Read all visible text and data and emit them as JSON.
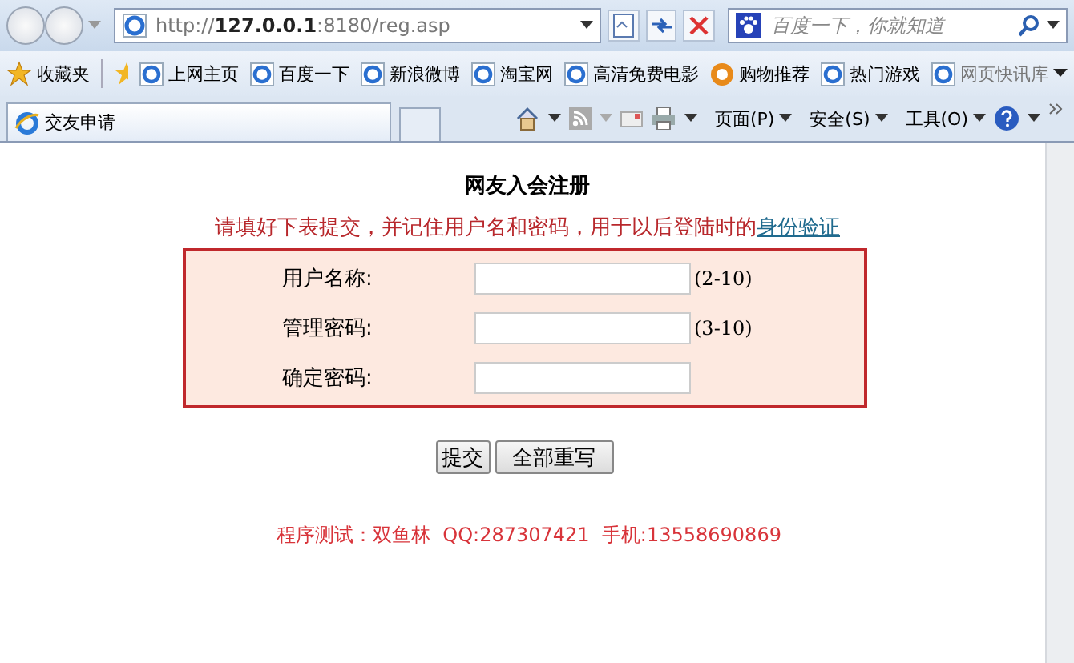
{
  "browser": {
    "address": "http://**127.0.0.1**:8180/reg.asp",
    "search_placeholder": "百度一下，你就知道",
    "favorites_label": "收藏夹",
    "favorites": [
      {
        "label": "上网主页",
        "kind": "ie"
      },
      {
        "label": "百度一下",
        "kind": "ie"
      },
      {
        "label": "新浪微博",
        "kind": "ie"
      },
      {
        "label": "淘宝网",
        "kind": "ie"
      },
      {
        "label": "高清免费电影",
        "kind": "ie"
      },
      {
        "label": "购物推荐",
        "kind": "shop"
      },
      {
        "label": "热门游戏",
        "kind": "ie"
      },
      {
        "label": "网页快讯库",
        "kind": "feed"
      }
    ],
    "tab": "交友申请",
    "commands": [
      "页面(P)",
      "安全(S)",
      "工具(O)"
    ]
  },
  "page": {
    "title": "网友入会注册",
    "notice": "请填好下表提交，并记住用户名和密码，用于以后登陆时的",
    "notice_link": "身份验证",
    "fields": [
      {
        "label": "用户名称:",
        "hint": "(2-10)"
      },
      {
        "label": "管理密码:",
        "hint": "(3-10)"
      },
      {
        "label": "确定密码:"
      }
    ],
    "buttons": [
      "提交",
      "全部重写"
    ],
    "footer": "程序测试：双鱼林  QQ:287307421  手机:13558690869"
  }
}
